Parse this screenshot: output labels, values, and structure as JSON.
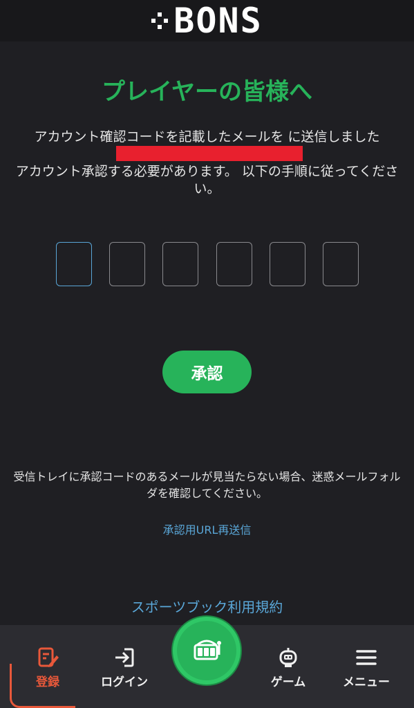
{
  "header": {
    "logo_text": "BONS"
  },
  "main": {
    "title": "プレイヤーの皆様へ",
    "message_line1": "アカウント確認コードを記載したメールを に送信しました",
    "message_line2": "アカウント承認する必要があります。 以下の手順に従ってください。",
    "code_boxes": [
      "",
      "",
      "",
      "",
      "",
      ""
    ],
    "confirm_label": "承認",
    "hint": "受信トレイに承認コードのあるメールが見当たらない場合、迷惑メールフォルダを確認してください。",
    "resend_link": "承認用URL再送信",
    "terms_link": "スポーツブック利用規約"
  },
  "bottom_nav": {
    "register": "登録",
    "login": "ログイン",
    "game": "ゲーム",
    "menu": "メニュー"
  },
  "colors": {
    "accent_green": "#27b35a",
    "link_blue": "#5aa7d8",
    "active_orange": "#e8583a",
    "redaction_red": "#e8202e"
  }
}
